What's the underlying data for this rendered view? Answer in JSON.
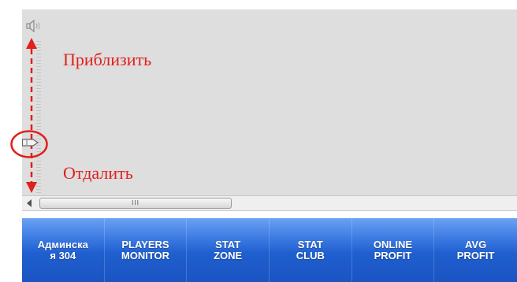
{
  "map": {
    "zoom_in_label": "Приблизить",
    "zoom_out_label": "Отдалить",
    "scroll_grip": "III"
  },
  "toolbar": {
    "buttons": [
      {
        "label": "Админска\nя 304"
      },
      {
        "label": "PLAYERS\nMONITOR"
      },
      {
        "label": "STAT\nZONE"
      },
      {
        "label": "STAT\nCLUB"
      },
      {
        "label": "ONLINE\nPROFIT"
      },
      {
        "label": "AVG\nPROFIT"
      }
    ]
  },
  "colors": {
    "annotation": "#e0201c",
    "toolbar_top": "#6aa2f4",
    "toolbar_bottom": "#1c54c2",
    "canvas_bg": "#dedede"
  },
  "icons": [
    "speaker-icon",
    "zoom-slider-thumb-icon",
    "scroll-left-arrow-icon"
  ]
}
